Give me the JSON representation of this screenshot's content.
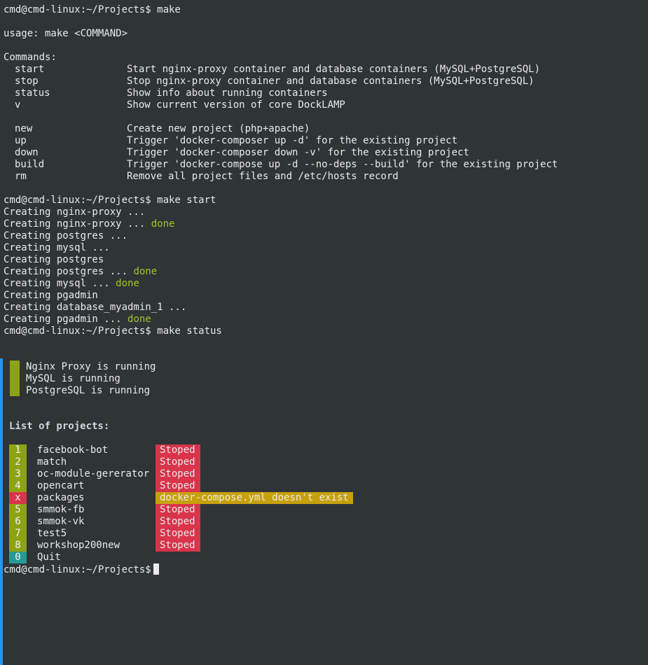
{
  "commands": {
    "prompt1": "cmd@cmd-linux:~/Projects$ make",
    "usage": "usage: make <COMMAND>",
    "header": "Commands:",
    "list": [
      {
        "cmd": "start",
        "desc": "Start nginx-proxy container and database containers (MySQL+PostgreSQL)"
      },
      {
        "cmd": "stop",
        "desc": "Stop nginx-proxy container and database containers (MySQL+PostgreSQL)"
      },
      {
        "cmd": "status",
        "desc": "Show info about running containers"
      },
      {
        "cmd": "v",
        "desc": "Show current version of core DockLAMP"
      },
      {
        "cmd": "new",
        "desc": "Create new project (php+apache)"
      },
      {
        "cmd": "up",
        "desc": "Trigger 'docker-composer up -d' for the existing project"
      },
      {
        "cmd": "down",
        "desc": "Trigger 'docker-composer down -v' for the existing project"
      },
      {
        "cmd": "build",
        "desc": "Trigger 'docker-compose up -d --no-deps --build' for the existing project"
      },
      {
        "cmd": "rm",
        "desc": "Remove all project files and /etc/hosts record"
      }
    ]
  },
  "start": {
    "prompt": "cmd@cmd-linux:~/Projects$ make start",
    "lines": [
      {
        "text": "Creating nginx-proxy ...",
        "done": ""
      },
      {
        "text": "Creating nginx-proxy ... ",
        "done": "done"
      },
      {
        "text": "Creating postgres ...",
        "done": ""
      },
      {
        "text": "Creating mysql ...",
        "done": ""
      },
      {
        "text": "Creating postgres",
        "done": ""
      },
      {
        "text": "Creating postgres ... ",
        "done": "done"
      },
      {
        "text": "Creating mysql ... ",
        "done": "done"
      },
      {
        "text": "Creating pgadmin",
        "done": ""
      },
      {
        "text": "Creating database_myadmin_1 ...",
        "done": ""
      },
      {
        "text": "Creating pgadmin ... ",
        "done": "done"
      }
    ]
  },
  "status": {
    "prompt": "cmd@cmd-linux:~/Projects$ make status",
    "running": [
      "Nginx Proxy is running",
      "MySQL is running",
      "PostgreSQL is running"
    ],
    "projects_title": "List of projects:",
    "projects": [
      {
        "num": "1",
        "name": "facebook-bot",
        "state": "Stoped",
        "kind": "ok"
      },
      {
        "num": "2",
        "name": "match",
        "state": "Stoped",
        "kind": "ok"
      },
      {
        "num": "3",
        "name": "oc-module-gererator",
        "state": "Stoped",
        "kind": "ok"
      },
      {
        "num": "4",
        "name": "opencart",
        "state": "Stoped",
        "kind": "ok"
      },
      {
        "num": "x",
        "name": "packages",
        "state": "docker-compose.yml doesn't exist",
        "kind": "missing"
      },
      {
        "num": "5",
        "name": "smmok-fb",
        "state": "Stoped",
        "kind": "ok"
      },
      {
        "num": "6",
        "name": "smmok-vk",
        "state": "Stoped",
        "kind": "ok"
      },
      {
        "num": "7",
        "name": "test5",
        "state": "Stoped",
        "kind": "ok"
      },
      {
        "num": "8",
        "name": "workshop200new",
        "state": "Stoped",
        "kind": "ok"
      }
    ],
    "quit": {
      "num": "0",
      "name": "Quit"
    }
  },
  "final_prompt": "cmd@cmd-linux:~/Projects$",
  "colors": {
    "background": "#2f3437",
    "done_green": "#a7c321",
    "badge_green": "#8ea312",
    "badge_red": "#d8344a",
    "badge_teal": "#249c95",
    "warning_orange": "#c7a10c",
    "edge_blue": "#2196f3"
  }
}
